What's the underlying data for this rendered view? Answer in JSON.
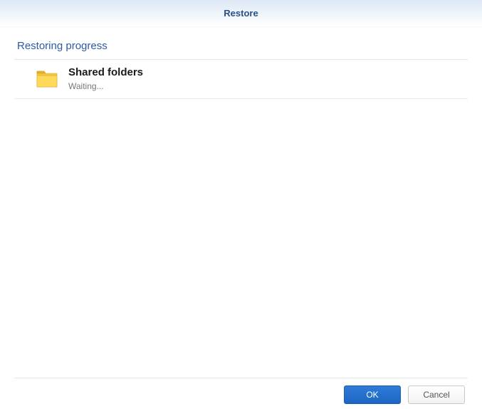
{
  "window": {
    "title": "Restore"
  },
  "section": {
    "heading": "Restoring progress"
  },
  "items": [
    {
      "title": "Shared folders",
      "status": "Waiting..."
    }
  ],
  "buttons": {
    "ok": "OK",
    "cancel": "Cancel"
  }
}
